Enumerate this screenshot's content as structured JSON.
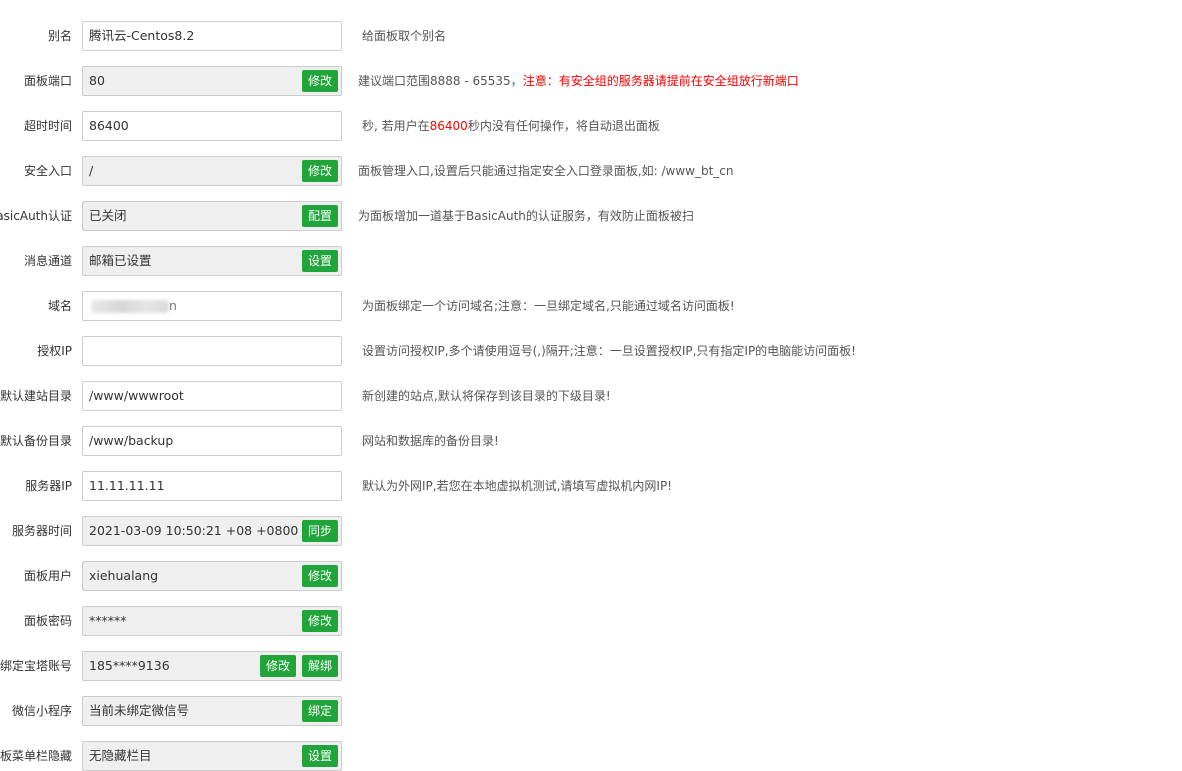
{
  "rows": {
    "alias": {
      "label": "别名",
      "value": "腾讯云-Centos8.2",
      "hint": "给面板取个别名"
    },
    "port": {
      "label": "面板端口",
      "value": "80",
      "button": "修改",
      "hint": "建议端口范围8888 - 65535，",
      "hint_red": "注意：有安全组的服务器请提前在安全组放行新端口"
    },
    "timeout": {
      "label": "超时时间",
      "value": "86400",
      "hint_a": "秒, 若用户在",
      "hint_red": "86400",
      "hint_b": "秒内没有任何操作，将自动退出面板"
    },
    "entry": {
      "label": "安全入口",
      "value": "/",
      "button": "修改",
      "hint": "面板管理入口,设置后只能通过指定安全入口登录面板,如: /www_bt_cn"
    },
    "basicauth": {
      "label": "BasicAuth认证",
      "value": "已关闭",
      "button": "配置",
      "hint": "为面板增加一道基于BasicAuth的认证服务，有效防止面板被扫"
    },
    "msg": {
      "label": "消息通道",
      "value": "邮箱已设置",
      "button": "设置"
    },
    "domain": {
      "label": "域名",
      "value_tail": "n",
      "hint": "为面板绑定一个访问域名;注意：一旦绑定域名,只能通过域名访问面板!"
    },
    "ip": {
      "label": "授权IP",
      "value": "",
      "hint": "设置访问授权IP,多个请使用逗号(,)隔开;注意：一旦设置授权IP,只有指定IP的电脑能访问面板!"
    },
    "siteroot": {
      "label": "默认建站目录",
      "value": "/www/wwwroot",
      "hint": "新创建的站点,默认将保存到该目录的下级目录!"
    },
    "backup": {
      "label": "默认备份目录",
      "value": "/www/backup",
      "hint": "网站和数据库的备份目录!"
    },
    "serverip": {
      "label": "服务器IP",
      "value": "11.11.11.11",
      "hint": "默认为外网IP,若您在本地虚拟机测试,请填写虚拟机内网IP!"
    },
    "time": {
      "label": "服务器时间",
      "value": "2021-03-09 10:50:21 +08 +0800",
      "button": "同步"
    },
    "user": {
      "label": "面板用户",
      "value": "xiehualang",
      "button": "修改"
    },
    "pass": {
      "label": "面板密码",
      "value": "******",
      "button": "修改"
    },
    "account": {
      "label": "绑定宝塔账号",
      "value": "185****9136",
      "button1": "修改",
      "button2": "解绑"
    },
    "wechat": {
      "label": "微信小程序",
      "value": "当前未绑定微信号",
      "button": "绑定"
    },
    "menu": {
      "label": "面板菜单栏隐藏",
      "value": "无隐藏栏目",
      "button": "设置"
    }
  }
}
